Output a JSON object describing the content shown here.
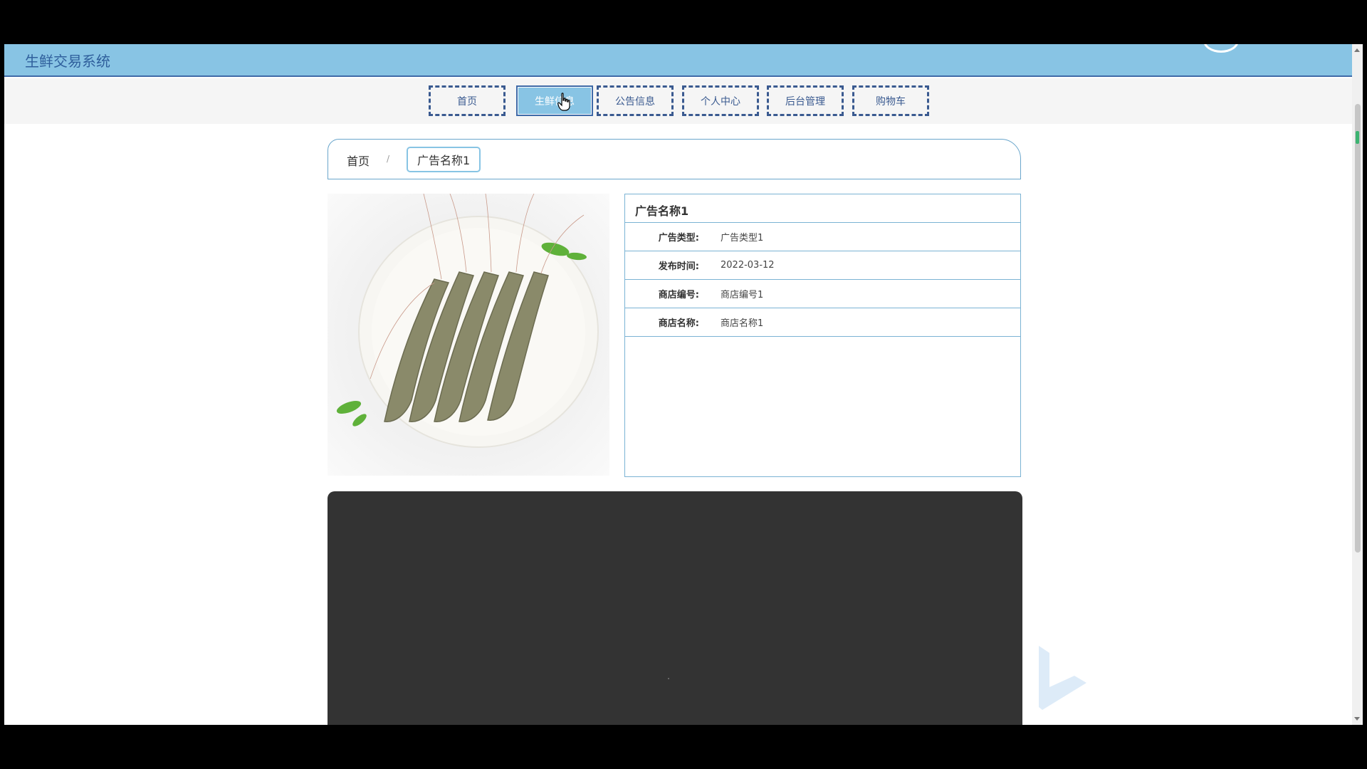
{
  "header": {
    "site_title": "生鲜交易系统"
  },
  "nav": {
    "items": [
      {
        "label": "首页"
      },
      {
        "label": "生鲜信息"
      },
      {
        "label": "公告信息"
      },
      {
        "label": "个人中心"
      },
      {
        "label": "后台管理"
      },
      {
        "label": "购物车"
      }
    ],
    "active_index": 1
  },
  "breadcrumb": {
    "home": "首页",
    "separator": "/",
    "current": "广告名称1"
  },
  "detail": {
    "title": "广告名称1",
    "rows": [
      {
        "label": "广告类型:",
        "value": "广告类型1"
      },
      {
        "label": "发布时间:",
        "value": "2022-03-12"
      },
      {
        "label": "商店编号:",
        "value": "商店编号1"
      },
      {
        "label": "商店名称:",
        "value": "商店名称1"
      }
    ]
  },
  "colors": {
    "header_bg": "#88c4e4",
    "nav_border": "#3a5a90",
    "panel_border": "#7bb3d4",
    "video_bg": "#333333"
  },
  "icons": {
    "cursor": "hand-pointer-icon",
    "watermark": "video-logo-icon"
  }
}
